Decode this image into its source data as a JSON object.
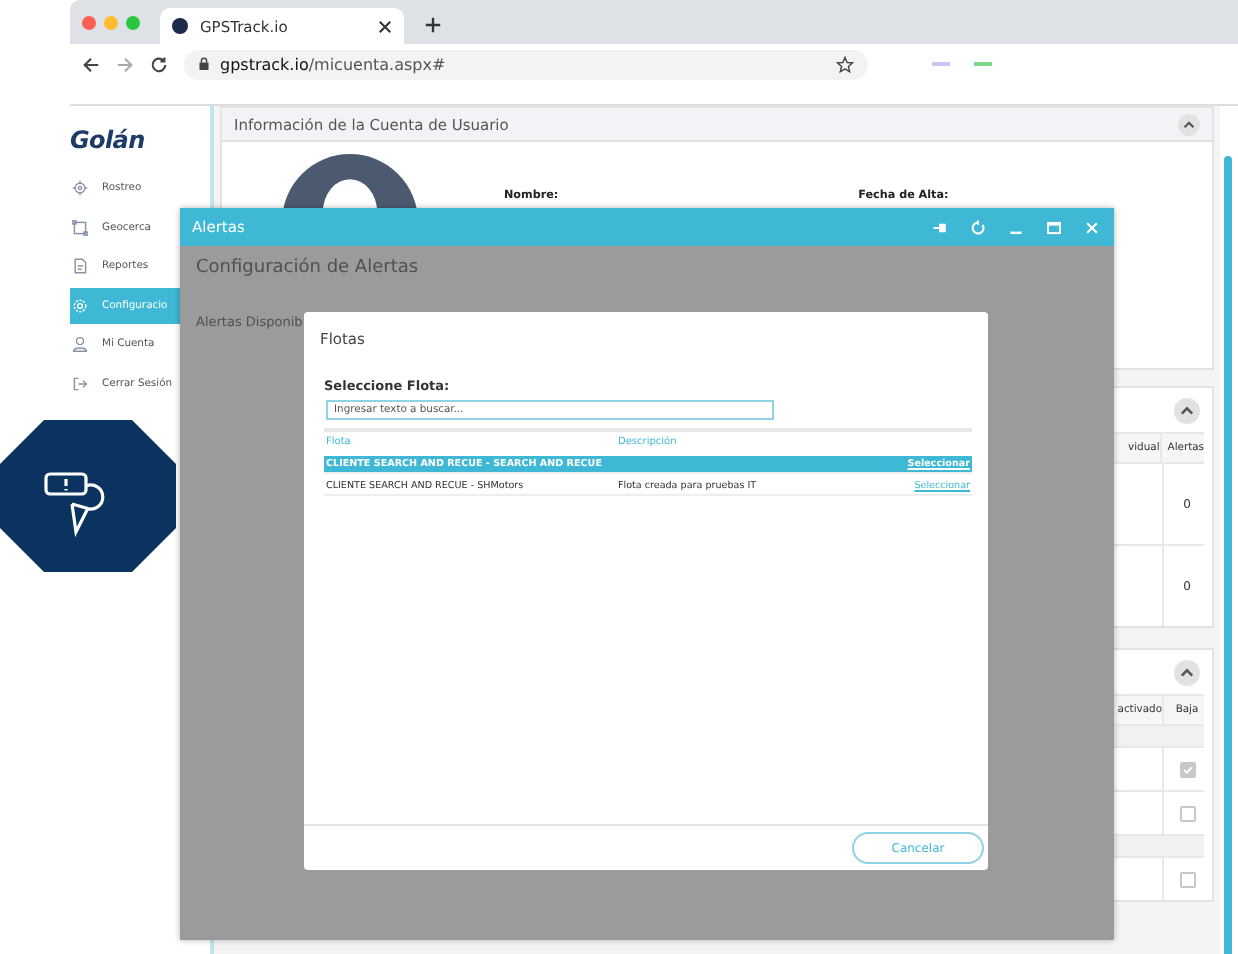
{
  "browser": {
    "tab_title": "GPSTrack.io",
    "url_host": "gpstrack.io",
    "url_path": "/micuenta.aspx#"
  },
  "sidebar": {
    "logo": "Golán",
    "items": [
      {
        "label": "Rostreo",
        "kind": "target",
        "selected": false
      },
      {
        "label": "Geocerca",
        "kind": "area",
        "selected": false
      },
      {
        "label": "Reportes",
        "kind": "report",
        "selected": false
      },
      {
        "label": "Configuracio",
        "kind": "gear",
        "selected": true
      },
      {
        "label": "Mi Cuenta",
        "kind": "user",
        "selected": false
      },
      {
        "label": "Cerrar Sesión",
        "kind": "logout",
        "selected": false
      }
    ]
  },
  "account_card": {
    "title": "Información de la Cuenta de Usuario",
    "fields": [
      "Nombre:",
      "Fecha de Alta:"
    ]
  },
  "summary_card": {
    "columns": [
      "vidual",
      "Alertas"
    ],
    "rows": [
      "0",
      "0"
    ]
  },
  "status_card": {
    "columns": [
      "activado",
      "Baja"
    ],
    "rows": [
      {
        "kind": "group"
      },
      {
        "kind": "check",
        "checked": true
      },
      {
        "kind": "check",
        "checked": false
      },
      {
        "kind": "group"
      },
      {
        "kind": "check",
        "checked": false
      }
    ]
  },
  "alert_window": {
    "title": "Alertas",
    "heading": "Configuración de Alertas",
    "label": "Alertas Disponib"
  },
  "fleet_dialog": {
    "title": "Flotas",
    "prompt": "Seleccione Flota:",
    "search": {
      "placeholder": "Ingresar texto a buscar..."
    },
    "columns": [
      "Flota",
      "Descripción"
    ],
    "rows": [
      {
        "fleet": "CLIENTE SEARCH AND RECUE - SEARCH AND RECUE",
        "action": "Seleccionar",
        "selected": true
      },
      {
        "fleet": "CLIENTE SEARCH AND RECUE - SHMotors",
        "description": "Flota creada para pruebas IT",
        "action": "Seleccionar",
        "selected": false
      }
    ],
    "cancel": "Cancelar"
  }
}
